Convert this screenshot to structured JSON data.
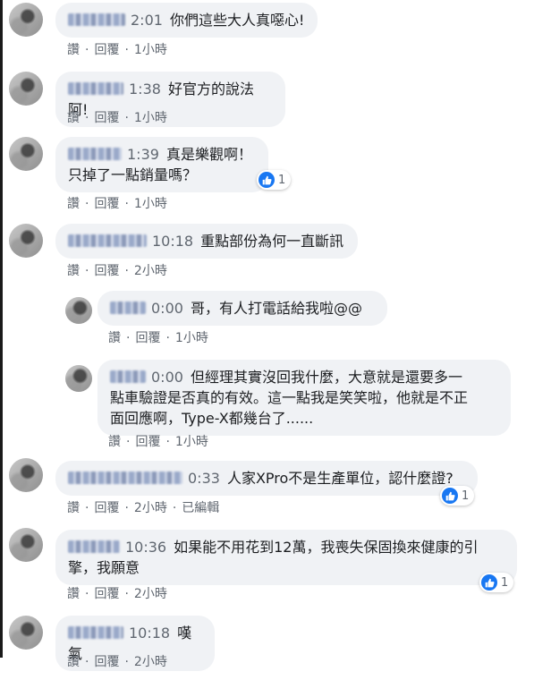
{
  "ui": {
    "like": "讚",
    "reply": "回覆",
    "edited": "已編輯",
    "like_icon": "thumbs-up-icon",
    "accent": "#1877f2"
  },
  "comments": [
    {
      "time": "2:01",
      "text": "你們這些大人真噁心!",
      "age": "1小時"
    },
    {
      "time": "1:38",
      "text": "好官方的說法阿!",
      "age": "1小時"
    },
    {
      "time": "1:39",
      "text": "真是樂觀啊！\n只掉了一點銷量嗎？",
      "age": "1小時",
      "reactions": "1"
    },
    {
      "time": "10:18",
      "text": "重點部份為何一直斷訊",
      "age": "2小時",
      "replies": [
        {
          "time": "0:00",
          "text": "哥，有人打電話給我啦@@",
          "age": "1小時"
        },
        {
          "time": "0:00",
          "text": "但經理其實沒回我什麼，大意就是還要多一\n點車驗證是否真的有效。這一點我是笑笑啦，他就是不正\n面回應啊，Type-X都幾台了......",
          "age": "1小時"
        }
      ]
    },
    {
      "time": "0:33",
      "text": "人家XPro不是生產單位，認什麼證?",
      "age": "2小時",
      "reactions": "1"
    },
    {
      "time": "10:36",
      "text": "如果能不用花到12萬，我喪失保固換來健康的引\n擎，我願意",
      "age": "2小時",
      "reactions": "1"
    },
    {
      "time": "10:18",
      "text": "嘆氣",
      "age": "2小時"
    }
  ]
}
